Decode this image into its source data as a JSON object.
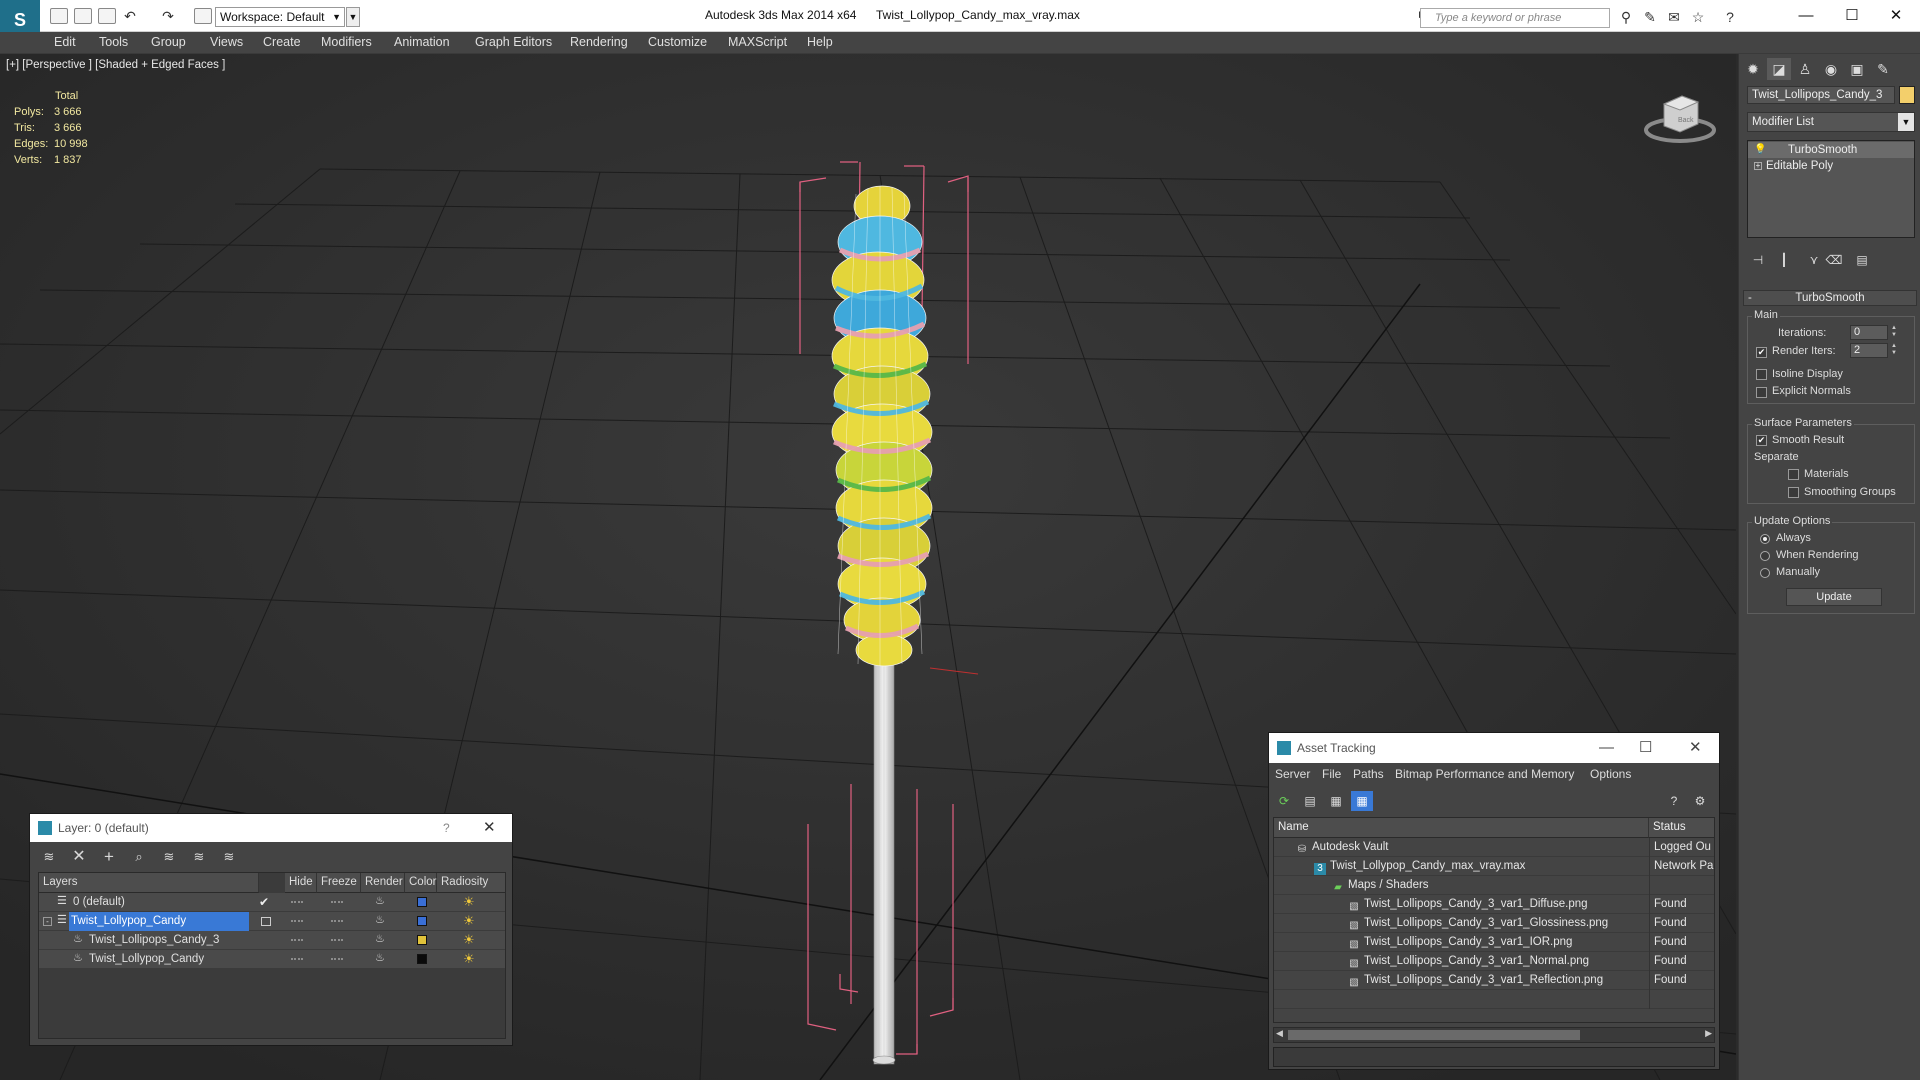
{
  "titlebar": {
    "app_title": "Autodesk 3ds Max  2014 x64",
    "doc_title": "Twist_Lollypop_Candy_max_vray.max",
    "workspace": "Workspace: Default",
    "search_placeholder": "Type a keyword or phrase"
  },
  "menu": [
    "Edit",
    "Tools",
    "Group",
    "Views",
    "Create",
    "Modifiers",
    "Animation",
    "Graph Editors",
    "Rendering",
    "Customize",
    "MAXScript",
    "Help"
  ],
  "viewport": {
    "label": "[+] [Perspective ] [Shaded + Edged Faces ]",
    "stats_header": "Total",
    "stats": [
      {
        "label": "Polys:",
        "value": "3 666"
      },
      {
        "label": "Tris:",
        "value": "3 666"
      },
      {
        "label": "Edges:",
        "value": "10 998"
      },
      {
        "label": "Verts:",
        "value": "1 837"
      }
    ],
    "viewcube_label": "Back"
  },
  "command_panel": {
    "object_name": "Twist_Lollipops_Candy_3",
    "object_color": "#f3cf6b",
    "modifier_list": "Modifier List",
    "stack": [
      "TurboSmooth",
      "Editable Poly"
    ],
    "rollout_title": "TurboSmooth",
    "main_group": "Main",
    "iterations_label": "Iterations:",
    "iterations_value": "0",
    "render_iters_label": "Render Iters:",
    "render_iters_value": "2",
    "isoline_label": "Isoline Display",
    "explicit_normals_label": "Explicit Normals",
    "surface_group": "Surface Parameters",
    "smooth_result_label": "Smooth Result",
    "separate_label": "Separate",
    "materials_label": "Materials",
    "smoothing_groups_label": "Smoothing Groups",
    "update_group": "Update Options",
    "always_label": "Always",
    "when_rendering_label": "When Rendering",
    "manually_label": "Manually",
    "update_button": "Update"
  },
  "layer_dialog": {
    "title": "Layer: 0 (default)",
    "help": "?",
    "columns": [
      "Layers",
      "Hide",
      "Freeze",
      "Render",
      "Color",
      "Radiosity"
    ],
    "rows": [
      {
        "name": "0 (default)",
        "color": "#3a6fd6",
        "indent": 0
      },
      {
        "name": "Twist_Lollypop_Candy",
        "color": "#3a6fd6",
        "indent": 0
      },
      {
        "name": "Twist_Lollipops_Candy_3",
        "color": "#e0c23a",
        "indent": 1
      },
      {
        "name": "Twist_Lollypop_Candy",
        "color": "#0a0a0a",
        "indent": 1
      }
    ]
  },
  "asset_dialog": {
    "title": "Asset Tracking",
    "menu": [
      "Server",
      "File",
      "Paths",
      "Bitmap Performance and Memory",
      "Options"
    ],
    "columns": [
      "Name",
      "Status"
    ],
    "rows": [
      {
        "name": "Autodesk Vault",
        "status": "Logged Ou",
        "indent": 1
      },
      {
        "name": "Twist_Lollypop_Candy_max_vray.max",
        "status": "Network Pa",
        "indent": 2
      },
      {
        "name": "Maps / Shaders",
        "status": "",
        "indent": 3
      },
      {
        "name": "Twist_Lollipops_Candy_3_var1_Diffuse.png",
        "status": "Found",
        "indent": 4
      },
      {
        "name": "Twist_Lollipops_Candy_3_var1_Glossiness.png",
        "status": "Found",
        "indent": 4
      },
      {
        "name": "Twist_Lollipops_Candy_3_var1_IOR.png",
        "status": "Found",
        "indent": 4
      },
      {
        "name": "Twist_Lollipops_Candy_3_var1_Normal.png",
        "status": "Found",
        "indent": 4
      },
      {
        "name": "Twist_Lollipops_Candy_3_var1_Reflection.png",
        "status": "Found",
        "indent": 4
      }
    ]
  }
}
